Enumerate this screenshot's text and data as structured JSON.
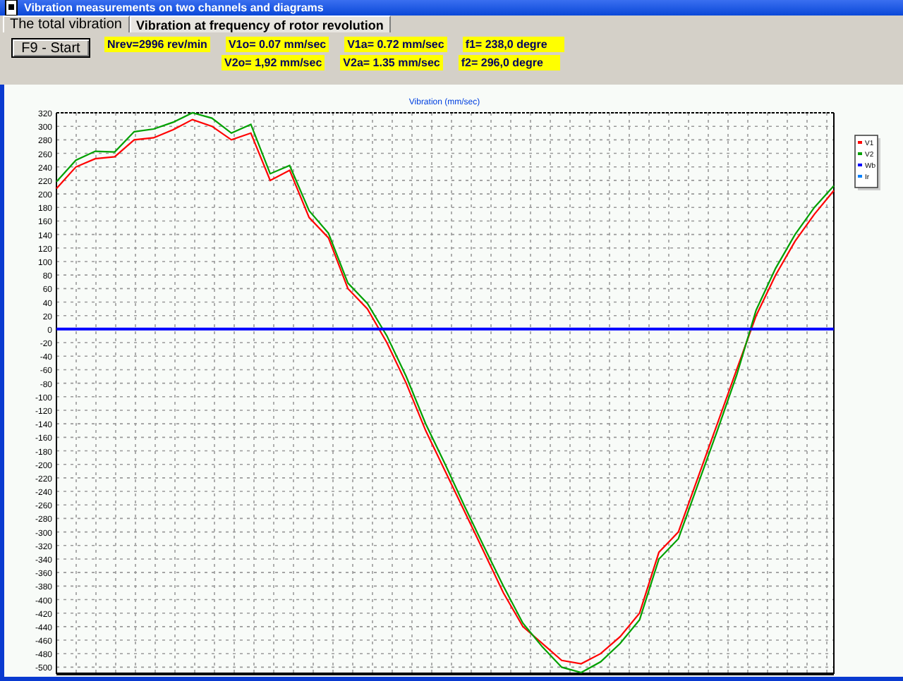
{
  "window": {
    "title": "Vibration measurements on two channels and diagrams"
  },
  "tabs": [
    {
      "label": "The total vibration",
      "selected": false
    },
    {
      "label": "Vibration at frequency of rotor revolution",
      "selected": true
    }
  ],
  "start_button": "F9 - Start",
  "reading_rows": [
    [
      "Nrev=2996 rev/min",
      "V1o= 0.07 mm/sec",
      "V1a= 0.72 mm/sec",
      "f1= 238,0 degre"
    ],
    [
      "V2o= 1,92 mm/sec",
      "V2a= 1.35 mm/sec",
      "f2= 296,0 degre"
    ]
  ],
  "chart": {
    "chart_data": {
      "type": "line",
      "title": "Vibration (mm/sec)",
      "ylim": [
        -510,
        320
      ],
      "grid": true,
      "legend": true,
      "yticks": [
        320,
        300,
        280,
        260,
        240,
        220,
        200,
        180,
        160,
        140,
        120,
        100,
        80,
        60,
        40,
        20,
        0,
        -20,
        -40,
        -60,
        -80,
        -100,
        -120,
        -140,
        -160,
        -180,
        -200,
        -220,
        -240,
        -260,
        -280,
        -300,
        -320,
        -340,
        -360,
        -380,
        -400,
        -420,
        -440,
        -460,
        -480,
        -500
      ],
      "series": [
        {
          "name": "V1",
          "color": "#ff0000",
          "values": [
            208,
            240,
            252,
            255,
            280,
            283,
            295,
            310,
            300,
            280,
            290,
            220,
            235,
            165,
            135,
            60,
            30,
            -20,
            -80,
            -150,
            -210,
            -270,
            -330,
            -390,
            -440,
            -465,
            -490,
            -495,
            -480,
            -455,
            -420,
            -330,
            -300,
            -220,
            -140,
            -60,
            20,
            80,
            130,
            170,
            205
          ]
        },
        {
          "name": "V2",
          "color": "#00a000",
          "values": [
            218,
            250,
            263,
            262,
            292,
            296,
            306,
            320,
            312,
            290,
            303,
            230,
            242,
            175,
            142,
            68,
            38,
            -10,
            -70,
            -140,
            -200,
            -262,
            -322,
            -380,
            -435,
            -470,
            -500,
            -508,
            -492,
            -465,
            -430,
            -340,
            -310,
            -230,
            -150,
            -68,
            28,
            90,
            140,
            180,
            212
          ]
        },
        {
          "name": "Wb",
          "color": "#0000ff",
          "values": [
            0,
            0,
            0,
            0,
            0,
            0,
            0,
            0,
            0,
            0,
            0,
            0,
            0,
            0,
            0,
            0,
            0,
            0,
            0,
            0,
            0,
            0,
            0,
            0,
            0,
            0,
            0,
            0,
            0,
            0,
            0,
            0,
            0,
            0,
            0,
            0,
            0,
            0,
            0,
            0,
            0
          ]
        },
        {
          "name": "Ir",
          "color": "#0080ff"
        }
      ]
    }
  }
}
